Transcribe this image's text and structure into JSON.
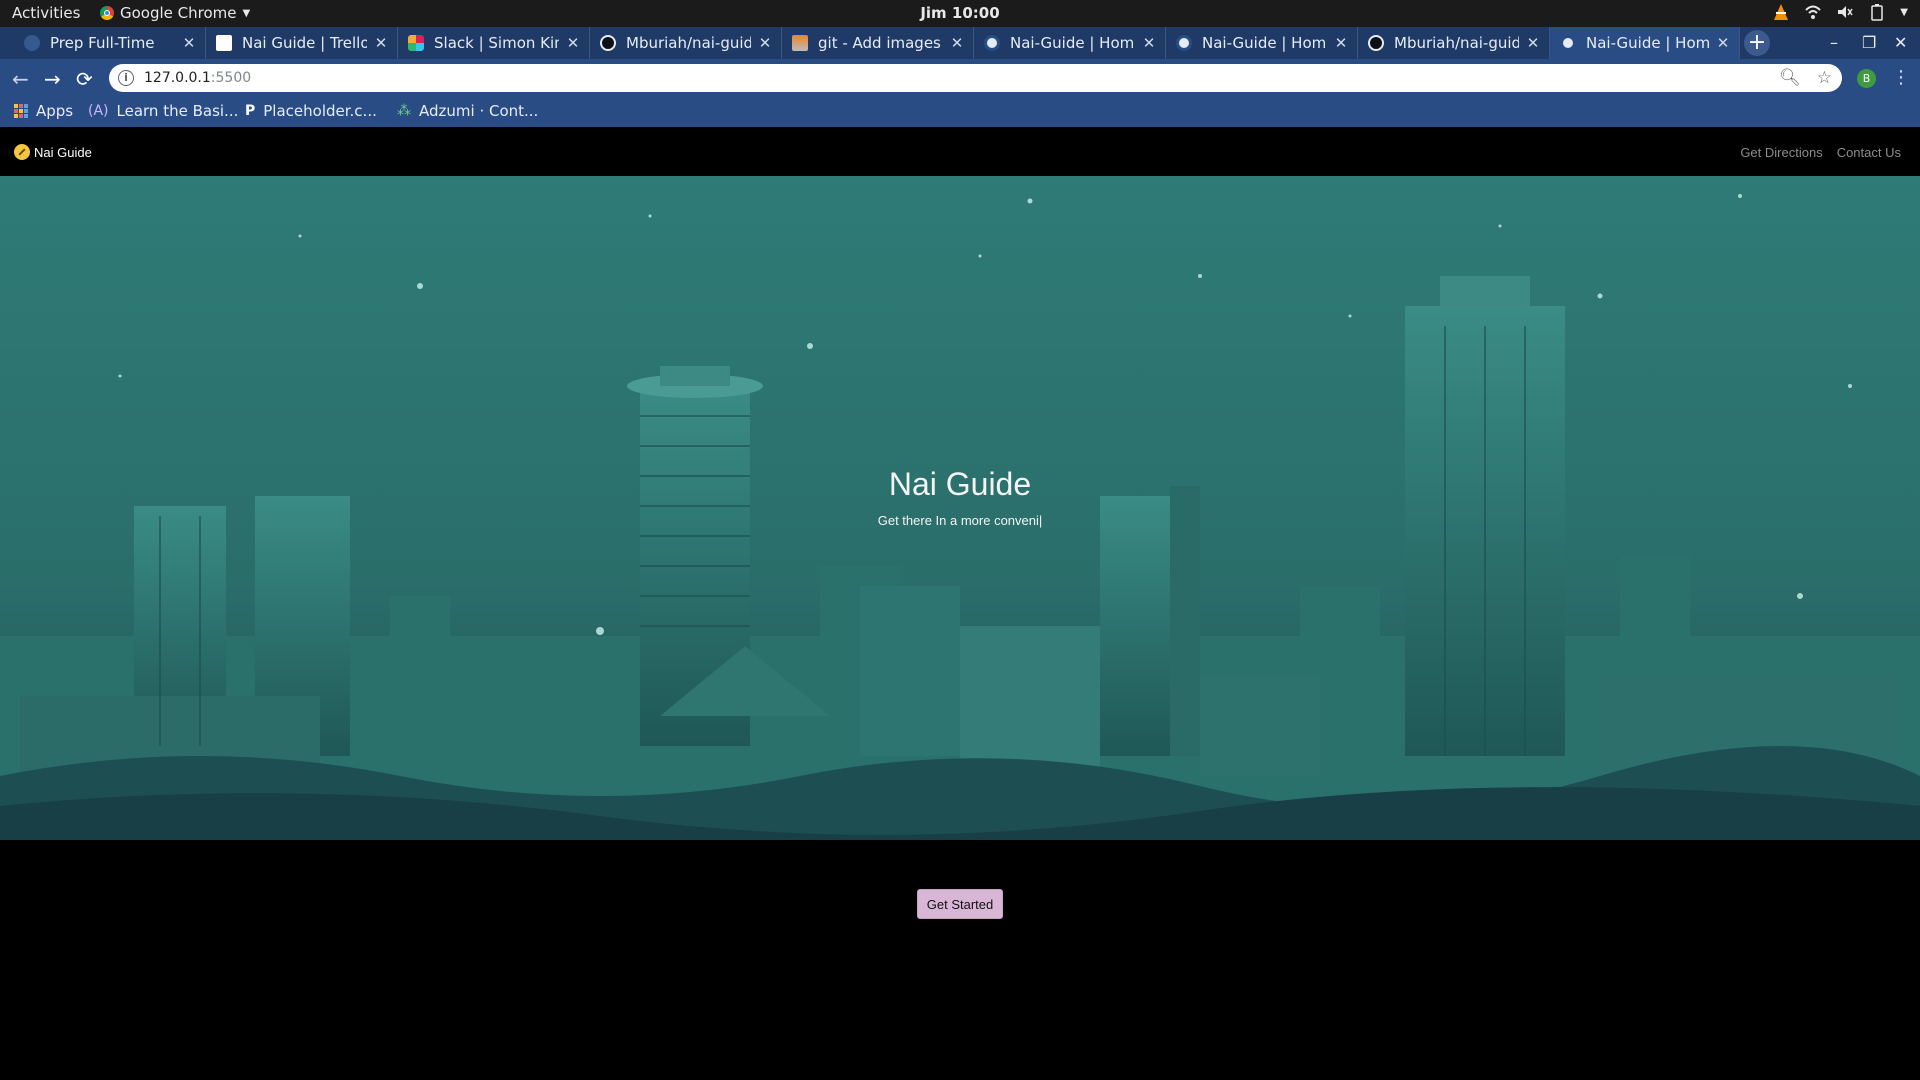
{
  "os_bar": {
    "activities": "Activities",
    "app_name": "Google Chrome",
    "clock": "Jim 10:00"
  },
  "browser": {
    "tabs": [
      {
        "label": "Prep Full-Time",
        "icon": "prep-icon",
        "active": false
      },
      {
        "label": "Nai Guide | Trello",
        "icon": "trello-icon",
        "active": false
      },
      {
        "label": "Slack | Simon Kima",
        "icon": "slack-icon",
        "active": false
      },
      {
        "label": "Mburiah/nai-guide",
        "icon": "github-icon",
        "active": false
      },
      {
        "label": "git - Add images to",
        "icon": "stackoverflow-icon",
        "active": false
      },
      {
        "label": "Nai-Guide | Home",
        "icon": "globe-icon",
        "active": false
      },
      {
        "label": "Nai-Guide | Home",
        "icon": "globe-icon",
        "active": false
      },
      {
        "label": "Mburiah/nai-guide",
        "icon": "github-icon",
        "active": false
      },
      {
        "label": "Nai-Guide | Home",
        "icon": "globe-icon",
        "active": true
      }
    ],
    "address": {
      "host": "127.0.0.1",
      "port": ":5500"
    },
    "profile_initial": "B",
    "bookmarks": [
      {
        "label": "Apps",
        "icon": "apps-grid-icon"
      },
      {
        "label": "Learn the Basi...",
        "icon": "learn-icon"
      },
      {
        "label": "Placeholder.c...",
        "icon": "placeholder-icon"
      },
      {
        "label": "Adzumi · Cont...",
        "icon": "adzumi-icon"
      }
    ]
  },
  "site": {
    "brand": "Nai Guide",
    "nav_links": [
      "Get Directions",
      "Contact Us"
    ],
    "hero": {
      "title": "Nai Guide",
      "subtitle": "Get there In a more conveni|"
    },
    "cta_label": "Get Started"
  },
  "colors": {
    "tab_strip": "#1f3a66",
    "toolbar": "#2a4c84",
    "hero_teal": "#2c7470",
    "cta_bg": "#dab6d6"
  }
}
